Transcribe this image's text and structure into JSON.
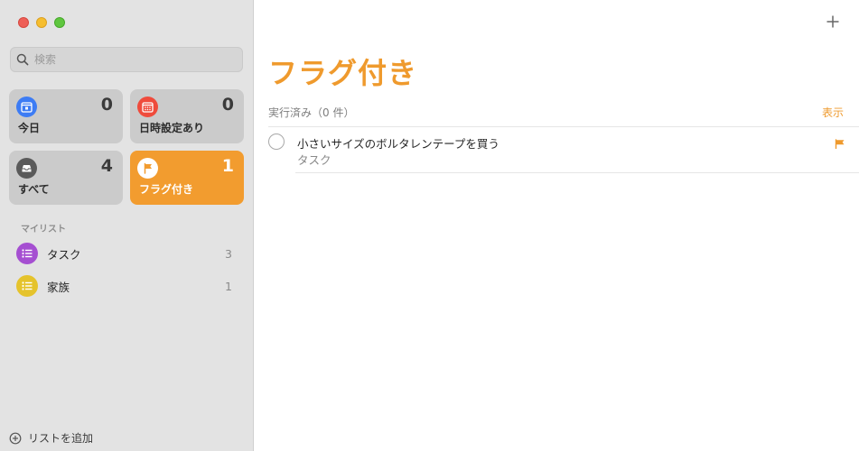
{
  "sidebar": {
    "search": {
      "placeholder": "検索",
      "value": ""
    },
    "cards": {
      "today": {
        "label": "今日",
        "count": "0",
        "color": "#3d7cf4"
      },
      "scheduled": {
        "label": "日時設定あり",
        "count": "0",
        "color": "#ef4b3c"
      },
      "all": {
        "label": "すべて",
        "count": "4",
        "color": "#5a5a5a"
      },
      "flagged": {
        "label": "フラグ付き",
        "count": "1",
        "color": "#f29c2f"
      }
    },
    "section_title": "マイリスト",
    "lists": [
      {
        "name": "タスク",
        "count": "3",
        "color": "#a54fd1"
      },
      {
        "name": "家族",
        "count": "1",
        "color": "#e5c32c"
      }
    ],
    "add_list_label": "リストを追加"
  },
  "main": {
    "title": "フラグ付き",
    "completed_label": "実行済み（0 件）",
    "show_label": "表示",
    "tasks": [
      {
        "title": "小さいサイズのボルタレンテープを買う",
        "list": "タスク",
        "flagged": true
      }
    ]
  },
  "colors": {
    "accent": "#ef9a2d"
  }
}
